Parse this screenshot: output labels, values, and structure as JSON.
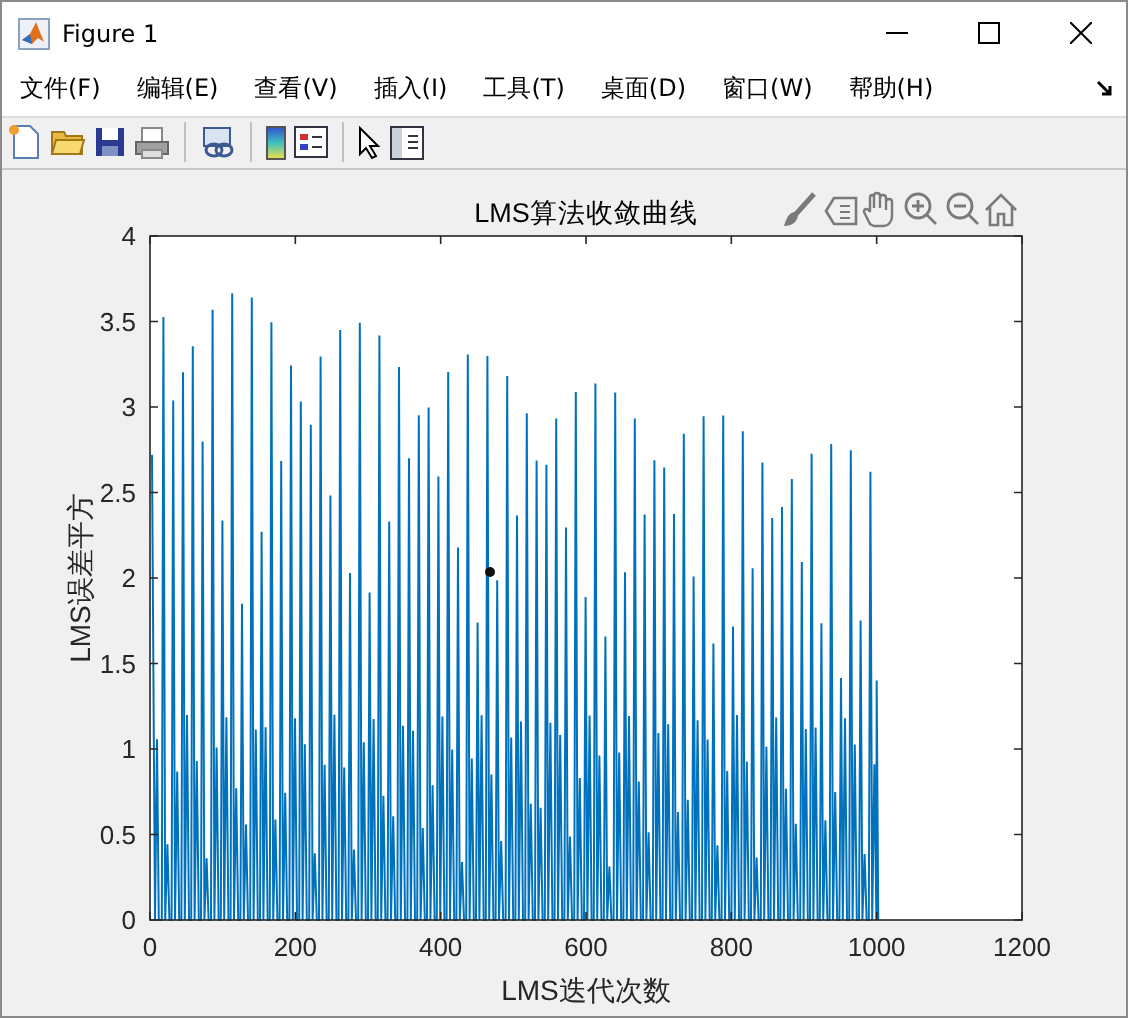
{
  "window": {
    "title": "Figure 1"
  },
  "menu": [
    {
      "label": "文件(F)"
    },
    {
      "label": "编辑(E)"
    },
    {
      "label": "查看(V)"
    },
    {
      "label": "插入(I)"
    },
    {
      "label": "工具(T)"
    },
    {
      "label": "桌面(D)"
    },
    {
      "label": "窗口(W)"
    },
    {
      "label": "帮助(H)"
    }
  ],
  "axes": {
    "title": "LMS算法收敛曲线",
    "xlabel": "LMS迭代次数",
    "ylabel": "LMS误差平方",
    "xticks": [
      "0",
      "200",
      "400",
      "600",
      "800",
      "1000",
      "1200"
    ],
    "yticks": [
      "4",
      "3.5",
      "3",
      "2.5",
      "2",
      "1.5",
      "1",
      "0.5",
      "0"
    ]
  }
}
